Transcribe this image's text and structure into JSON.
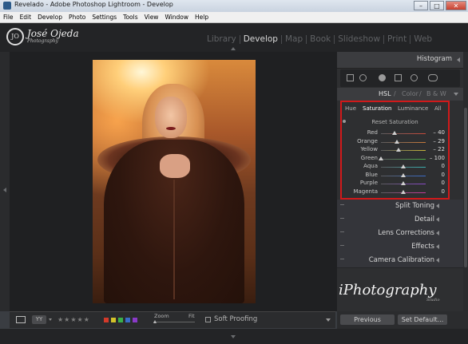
{
  "window": {
    "title": "Revelado - Adobe Photoshop Lightroom - Develop",
    "buttons": [
      "–",
      "□",
      "✕"
    ]
  },
  "menu": [
    "File",
    "Edit",
    "Develop",
    "Photo",
    "Settings",
    "Tools",
    "View",
    "Window",
    "Help"
  ],
  "identity": {
    "mark": "JO",
    "name": "José Ojeda",
    "sub": "Photography"
  },
  "modules": [
    "Library",
    "Develop",
    "Map",
    "Book",
    "Slideshow",
    "Print",
    "Web"
  ],
  "active_module": "Develop",
  "right_panel": {
    "histogram_label": "Histogram",
    "hsl_tabs": [
      "HSL",
      "/",
      "Color",
      "/",
      "B & W"
    ],
    "sub_tabs": [
      "Hue",
      "Saturation",
      "Luminance",
      "All"
    ],
    "selected_sub_tab": "Saturation",
    "reset_label": "Reset Saturation",
    "sliders": [
      {
        "name": "Red",
        "value": "– 40",
        "level": -40,
        "color": "#c84a3a"
      },
      {
        "name": "Orange",
        "value": "– 29",
        "level": -29,
        "color": "#c87a3a"
      },
      {
        "name": "Yellow",
        "value": "– 22",
        "level": -22,
        "color": "#c8b63a"
      },
      {
        "name": "Green",
        "value": "– 100",
        "level": -100,
        "color": "#4ab04a"
      },
      {
        "name": "Aqua",
        "value": "0",
        "level": 0,
        "color": "#3ab0b0"
      },
      {
        "name": "Blue",
        "value": "0",
        "level": 0,
        "color": "#3a6cc8"
      },
      {
        "name": "Purple",
        "value": "0",
        "level": 0,
        "color": "#8a4ac8"
      },
      {
        "name": "Magenta",
        "value": "0",
        "level": 0,
        "color": "#c83a9a"
      }
    ],
    "panels": [
      "Split Toning",
      "Detail",
      "Lens Corrections",
      "Effects",
      "Camera Calibration"
    ],
    "brand": "iPhotography",
    "brand_sub": "Studio",
    "buttons": {
      "previous": "Previous",
      "set_default": "Set Default..."
    }
  },
  "toolbar": {
    "stars": "★★★★★",
    "flags": [
      "#d33a2a",
      "#d3c22a",
      "#3ab04a",
      "#3a6cc8",
      "#8a3ac8"
    ],
    "zoom_label": "Zoom",
    "fit_label": "Fit",
    "soft_proofing": "Soft Proofing"
  }
}
